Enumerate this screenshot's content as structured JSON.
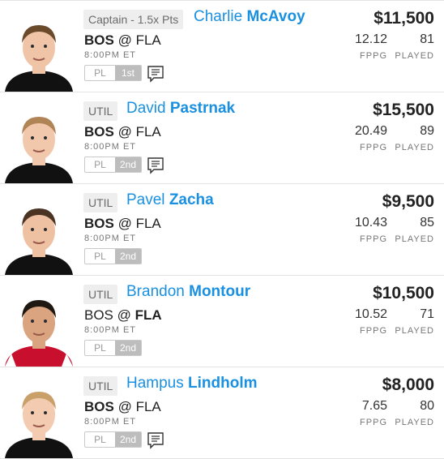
{
  "players": [
    {
      "position": "Captain - 1.5x Pts",
      "first": "Charlie",
      "last": "McAvoy",
      "team": "BOS",
      "at": "@",
      "opp": "FLA",
      "time": "8:00PM ET",
      "pl": "PL",
      "period": "1st",
      "salary": "$11,500",
      "fppg": "12.12",
      "played": "81",
      "fppg_label": "FPPG",
      "played_label": "PLAYED",
      "has_notes": true,
      "bold_side": "team"
    },
    {
      "position": "UTIL",
      "first": "David",
      "last": "Pastrnak",
      "team": "BOS",
      "at": "@",
      "opp": "FLA",
      "time": "8:00PM ET",
      "pl": "PL",
      "period": "2nd",
      "salary": "$15,500",
      "fppg": "20.49",
      "played": "89",
      "fppg_label": "FPPG",
      "played_label": "PLAYED",
      "has_notes": true,
      "bold_side": "team"
    },
    {
      "position": "UTIL",
      "first": "Pavel",
      "last": "Zacha",
      "team": "BOS",
      "at": "@",
      "opp": "FLA",
      "time": "8:00PM ET",
      "pl": "PL",
      "period": "2nd",
      "salary": "$9,500",
      "fppg": "10.43",
      "played": "85",
      "fppg_label": "FPPG",
      "played_label": "PLAYED",
      "has_notes": false,
      "bold_side": "team"
    },
    {
      "position": "UTIL",
      "first": "Brandon",
      "last": "Montour",
      "team": "BOS",
      "at": "@",
      "opp": "FLA",
      "time": "8:00PM ET",
      "pl": "PL",
      "period": "2nd",
      "salary": "$10,500",
      "fppg": "10.52",
      "played": "71",
      "fppg_label": "FPPG",
      "played_label": "PLAYED",
      "has_notes": false,
      "bold_side": "opp"
    },
    {
      "position": "UTIL",
      "first": "Hampus",
      "last": "Lindholm",
      "team": "BOS",
      "at": "@",
      "opp": "FLA",
      "time": "8:00PM ET",
      "pl": "PL",
      "period": "2nd",
      "salary": "$8,000",
      "fppg": "7.65",
      "played": "80",
      "fppg_label": "FPPG",
      "played_label": "PLAYED",
      "has_notes": true,
      "bold_side": "team"
    }
  ],
  "colors": {
    "name_blue": "#1a90e0",
    "chip_bg": "#eeeeee",
    "period_bg": "#bdbdbd",
    "bruins_jersey": "#111111",
    "panthers_jersey": "#c8102e"
  },
  "icons": {
    "notes": "notes-icon",
    "avatar": "player-headshot"
  }
}
